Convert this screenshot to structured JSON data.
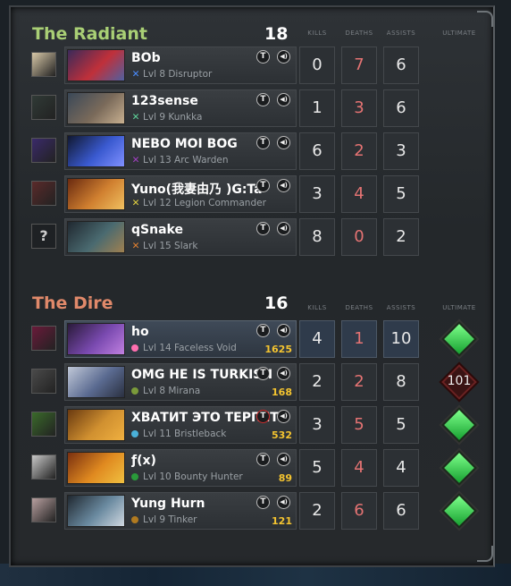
{
  "radiant": {
    "name": "The Radiant",
    "score": "18",
    "columns": {
      "kills": "KILLS",
      "deaths": "DEATHS",
      "assists": "ASSISTS",
      "ultimate": "ULTIMATE"
    },
    "players": [
      {
        "name": "BOb",
        "level": "Lvl 8",
        "hero": "Disruptor",
        "kills": "0",
        "deaths": "7",
        "assists": "6",
        "marker": "✕",
        "marker_color": "#4a8cff",
        "portrait": [
          "#3a2a5a",
          "#c0303a",
          "#5060a0"
        ],
        "avatar": "#d8c8a8"
      },
      {
        "name": "123sense",
        "level": "Lvl 9",
        "hero": "Kunkka",
        "kills": "1",
        "deaths": "3",
        "assists": "6",
        "marker": "✕",
        "marker_color": "#5ed39a",
        "portrait": [
          "#3a4858",
          "#7a6a5a",
          "#c8b090"
        ],
        "avatar": "#303a36"
      },
      {
        "name": "NEBO MOI BOG",
        "level": "Lvl 13",
        "hero": "Arc Warden",
        "kills": "6",
        "deaths": "2",
        "assists": "3",
        "marker": "✕",
        "marker_color": "#a040c0",
        "portrait": [
          "#101830",
          "#3a5ad0",
          "#8090ff"
        ],
        "avatar": "#3a2a6a"
      },
      {
        "name": "Yuno(我妻由乃 )G:Ta",
        "level": "Lvl 12",
        "hero": "Legion Commander",
        "kills": "3",
        "deaths": "4",
        "assists": "5",
        "marker": "✕",
        "marker_color": "#e0d040",
        "portrait": [
          "#6a2a10",
          "#d08030",
          "#f0c060"
        ],
        "avatar": "#5a2a2a"
      },
      {
        "name": "qSnake",
        "level": "Lvl 15",
        "hero": "Slark",
        "kills": "8",
        "deaths": "0",
        "assists": "2",
        "marker": "✕",
        "marker_color": "#e08030",
        "portrait": [
          "#202830",
          "#4a6a70",
          "#a08050"
        ],
        "avatar": "?"
      }
    ]
  },
  "dire": {
    "name": "The Dire",
    "score": "16",
    "columns": {
      "kills": "KILLS",
      "deaths": "DEATHS",
      "assists": "ASSISTS",
      "ultimate": "ULTIMATE"
    },
    "players": [
      {
        "name": "ho",
        "level": "Lvl 14",
        "hero": "Faceless Void",
        "gold": "1625",
        "kills": "4",
        "deaths": "1",
        "assists": "10",
        "marker_color": "#ff6fb0",
        "portrait": [
          "#2a1a3a",
          "#7a4ab0",
          "#c080e0"
        ],
        "avatar": "#6a1a3a",
        "ultimate": "ready",
        "me": true
      },
      {
        "name": "OMG HE IS TURKISH",
        "level": "Lvl 8",
        "hero": "Mirana",
        "gold": "168",
        "kills": "2",
        "deaths": "2",
        "assists": "8",
        "marker_color": "#7a9a3a",
        "portrait": [
          "#c0c8d8",
          "#5a6a90",
          "#2a3040"
        ],
        "avatar": "#4a4a4a",
        "ultimate": "101"
      },
      {
        "name": "ХВАТИТ ЭТО ТЕРПЕТЬ",
        "level": "Lvl 11",
        "hero": "Bristleback",
        "gold": "532",
        "kills": "3",
        "deaths": "5",
        "assists": "5",
        "marker_color": "#4ab0d8",
        "portrait": [
          "#6a3a10",
          "#d09030",
          "#f0b040"
        ],
        "avatar": "#3a6a2a",
        "ultimate": "ready",
        "muted": true
      },
      {
        "name": "ƒ(x)",
        "level": "Lvl 10",
        "hero": "Bounty Hunter",
        "gold": "89",
        "kills": "5",
        "deaths": "4",
        "assists": "4",
        "marker_color": "#2a9a3a",
        "portrait": [
          "#7a3010",
          "#e08a20",
          "#f0c040"
        ],
        "avatar": "#c8c8c8",
        "ultimate": "ready"
      },
      {
        "name": "Yung Hurn",
        "level": "Lvl 9",
        "hero": "Tinker",
        "gold": "121",
        "kills": "2",
        "deaths": "6",
        "assists": "6",
        "marker_color": "#b07a20",
        "portrait": [
          "#202830",
          "#6a8aa0",
          "#d0d8e0"
        ],
        "avatar": "#b8a0a0",
        "ultimate": "ready"
      }
    ]
  },
  "controls": {
    "talk_glyph": "T",
    "voice_glyph": "◀)"
  }
}
